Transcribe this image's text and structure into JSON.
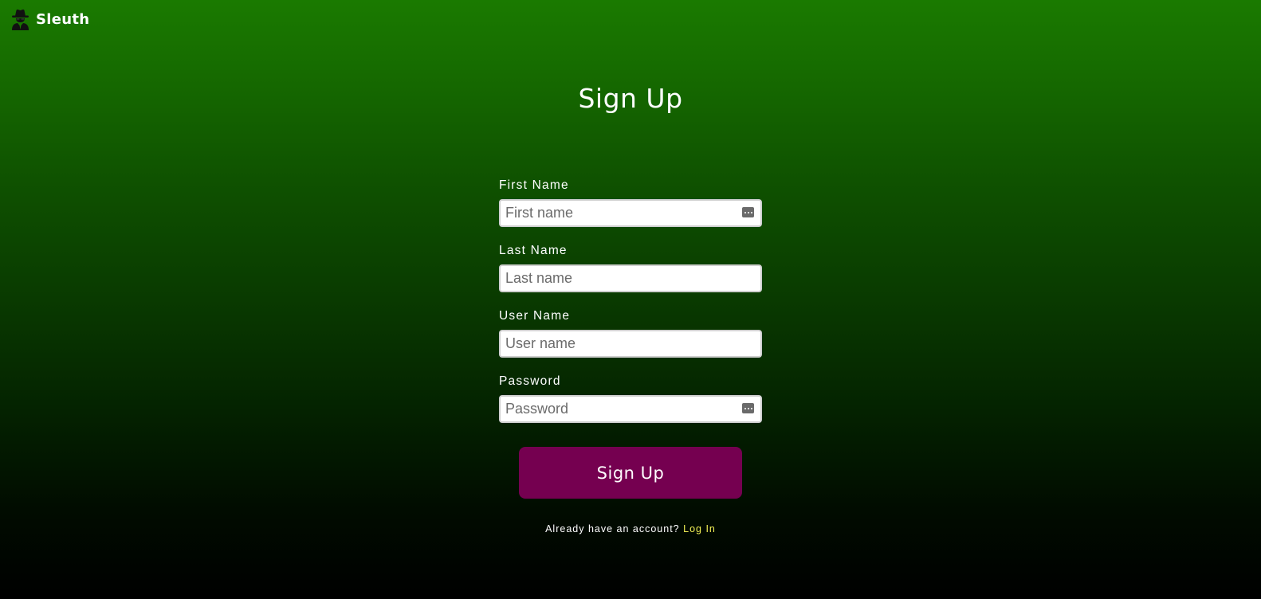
{
  "brand": {
    "name": "Sleuth",
    "icon": "spy-icon"
  },
  "page": {
    "title": "Sign Up"
  },
  "form": {
    "fields": [
      {
        "label": "First Name",
        "placeholder": "First name",
        "value": "",
        "autofill_icon": true
      },
      {
        "label": "Last Name",
        "placeholder": "Last name",
        "value": "",
        "autofill_icon": false
      },
      {
        "label": "User Name",
        "placeholder": "User name",
        "value": "",
        "autofill_icon": false
      },
      {
        "label": "Password",
        "placeholder": "Password",
        "value": "",
        "autofill_icon": true
      }
    ],
    "submit_label": "Sign Up"
  },
  "footer": {
    "prompt": "Already have an account?",
    "link_label": "Log In"
  },
  "colors": {
    "background_top": "#1a7a00",
    "background_bottom": "#000000",
    "button": "#750050",
    "link": "#f2f055"
  }
}
